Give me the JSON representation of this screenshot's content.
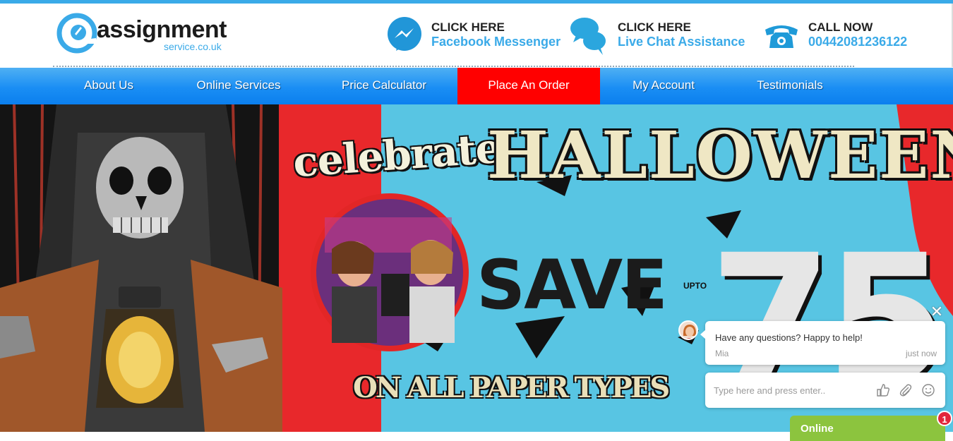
{
  "header": {
    "logo": {
      "name": "assignment",
      "domain": "service.co.uk"
    },
    "contacts": [
      {
        "icon": "messenger-icon",
        "line1": "CLICK HERE",
        "line2": "Facebook Messenger"
      },
      {
        "icon": "chat-bubbles-icon",
        "line1": "CLICK HERE",
        "line2": "Live Chat Assistance"
      },
      {
        "icon": "telephone-icon",
        "line1": "CALL NOW",
        "line2": "00442081236122"
      }
    ]
  },
  "nav": {
    "items": [
      {
        "label": "About Us"
      },
      {
        "label": "Online Services"
      },
      {
        "label": "Price Calculator"
      },
      {
        "label": "Place An Order",
        "active": true
      },
      {
        "label": "My Account"
      },
      {
        "label": "Testimonials"
      }
    ]
  },
  "hero": {
    "title_line1": "celebrate",
    "title_line2": "HALLOWEEN",
    "save": "SAVE",
    "upto": "UPTO",
    "percent": "75",
    "subtitle": "ON ALL PAPER TYPES"
  },
  "chat": {
    "close_symbol": "✕",
    "message": "Have any questions? Happy to help!",
    "agent": "Mia",
    "time": "just now",
    "input_placeholder": "Type here and press enter..",
    "status": "Online",
    "badge_count": "1"
  },
  "colors": {
    "accent_blue": "#3aaae8",
    "nav_active": "#ff0000",
    "online_green": "#8cc43e",
    "badge_red": "#e2263b"
  }
}
